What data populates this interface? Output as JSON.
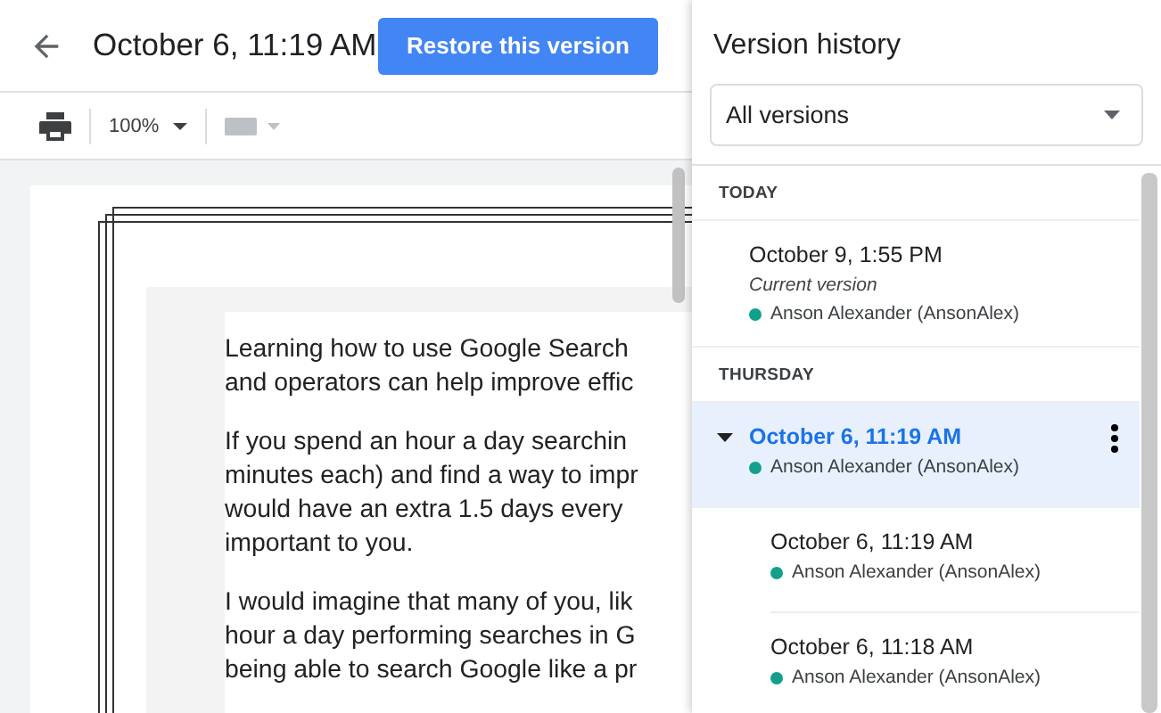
{
  "header": {
    "title": "October 6, 11:19 AM",
    "restore_button": "Restore this version"
  },
  "toolbar": {
    "zoom": "100%"
  },
  "document": {
    "paragraphs": [
      [
        "Learning how to use Google Search",
        "and operators can help improve effic"
      ],
      [
        "If you spend an hour a day searchin",
        "minutes each) and find a way to impr",
        "would have an extra 1.5 days every",
        "important to you."
      ],
      [
        "I would imagine that many of you, lik",
        "hour a day performing searches in G",
        "being able to search Google like a pr"
      ]
    ]
  },
  "panel": {
    "title": "Version history",
    "filter": {
      "value": "All versions"
    },
    "groups": [
      {
        "label": "TODAY",
        "versions": [
          {
            "time": "October 9, 1:55 PM",
            "note": "Current version",
            "author": "Anson Alexander (AnsonAlex)",
            "color": "#12a08a",
            "selected": false
          }
        ]
      },
      {
        "label": "THURSDAY",
        "versions": [
          {
            "time": "October 6, 11:19 AM",
            "author": "Anson Alexander (AnsonAlex)",
            "color": "#12a08a",
            "selected": true,
            "expanded": true,
            "children": [
              {
                "time": "October 6, 11:19 AM",
                "author": "Anson Alexander (AnsonAlex)",
                "color": "#12a08a",
                "selected": false
              },
              {
                "time": "October 6, 11:18 AM",
                "author": "Anson Alexander (AnsonAlex)",
                "color": "#12a08a",
                "selected": false
              }
            ]
          }
        ]
      }
    ]
  }
}
